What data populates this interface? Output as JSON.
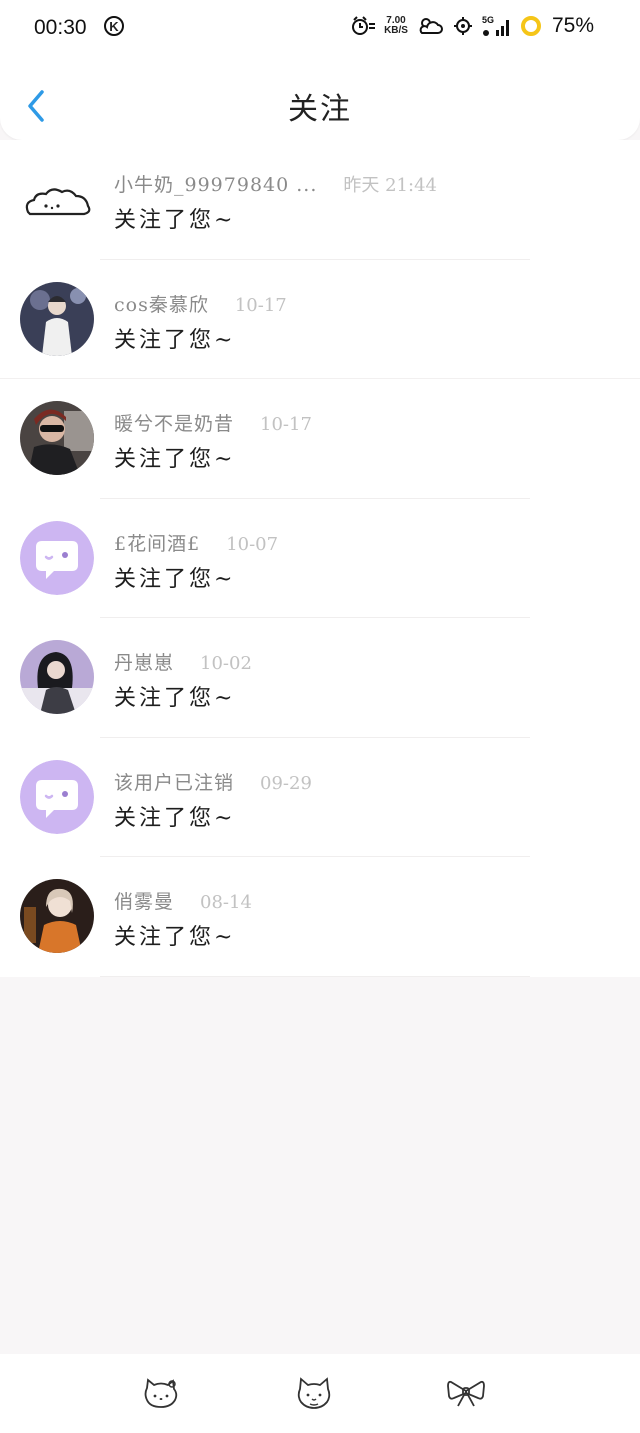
{
  "status_bar": {
    "time": "00:30",
    "badge": "K",
    "speed_value": "7.00",
    "speed_unit": "KB/S",
    "network": "5G",
    "battery": "75%"
  },
  "header": {
    "title": "关注",
    "back_icon": "chevron-left-icon"
  },
  "colors": {
    "accent": "#2e9ae6",
    "placeholder_avatar": "#cdb6f2"
  },
  "items": [
    {
      "name": "小牛奶_99979840 ...",
      "date": "昨天 21:44",
      "message": "关注了您~",
      "avatar": "cloud-doodle-icon"
    },
    {
      "name": "cos秦慕欣",
      "date": "10-17",
      "message": "关注了您~",
      "avatar": "photo-avatar"
    },
    {
      "name": "暖兮不是奶昔",
      "date": "10-17",
      "message": "关注了您~",
      "avatar": "photo-avatar"
    },
    {
      "name": "£花间酒£",
      "date": "10-07",
      "message": "关注了您~",
      "avatar": "chat-bubble-icon"
    },
    {
      "name": "丹崽崽",
      "date": "10-02",
      "message": "关注了您~",
      "avatar": "photo-avatar"
    },
    {
      "name": "该用户已注销",
      "date": "09-29",
      "message": "关注了您~",
      "avatar": "chat-bubble-icon"
    },
    {
      "name": "俏雾曼",
      "date": "08-14",
      "message": "关注了您~",
      "avatar": "photo-avatar"
    }
  ],
  "bottom_nav": {
    "items": [
      "hello-kitty-icon",
      "cat-face-icon",
      "bow-icon"
    ]
  }
}
